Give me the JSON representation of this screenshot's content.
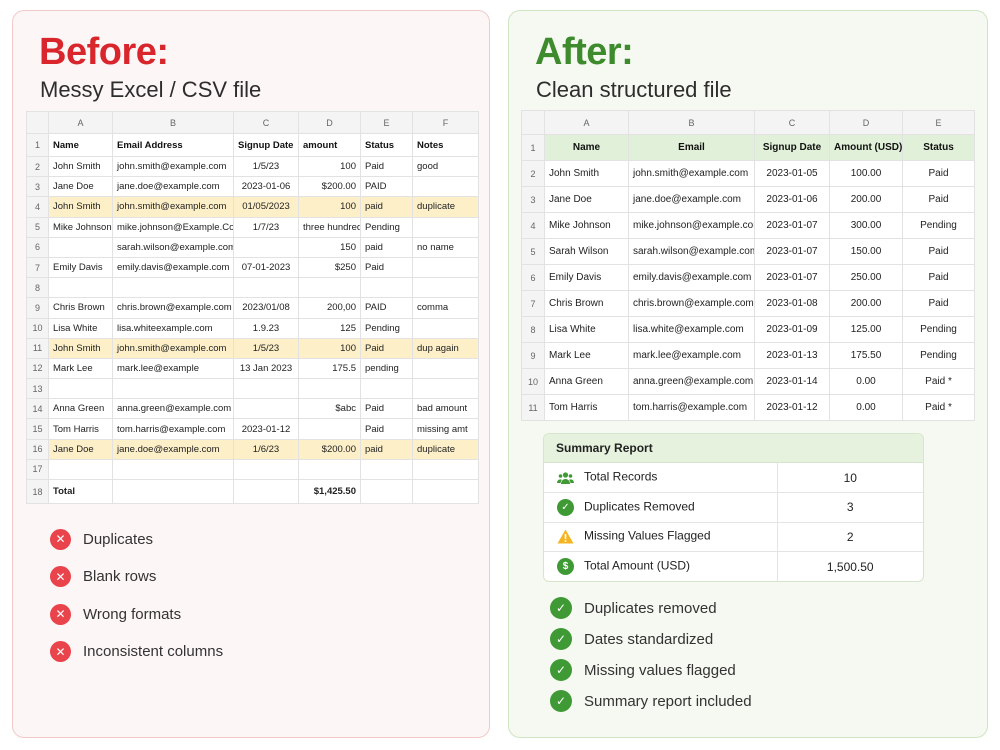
{
  "before": {
    "title": "Before:",
    "subtitle": "Messy Excel / CSV file",
    "columns": [
      "A",
      "B",
      "C",
      "D",
      "E",
      "F"
    ],
    "rows": [
      {
        "n": "1",
        "cells": [
          "Name",
          "Email Address",
          "Signup Date",
          "amount",
          "Status",
          "Notes"
        ]
      },
      {
        "n": "2",
        "cells": [
          "John Smith",
          "john.smith@example.com",
          "1/5/23",
          "100",
          "Paid",
          "good"
        ]
      },
      {
        "n": "3",
        "cells": [
          "Jane Doe",
          "jane.doe@example.com",
          "2023-01-06",
          "$200.00",
          "PAID",
          ""
        ]
      },
      {
        "n": "4",
        "cells": [
          "John Smith",
          "john.smith@example.com",
          "01/05/2023",
          "100",
          "paid",
          "duplicate"
        ]
      },
      {
        "n": "5",
        "cells": [
          "Mike Johnson",
          "mike.johnson@Example.Com",
          "1/7/23",
          "three hundred",
          "Pending",
          ""
        ]
      },
      {
        "n": "6",
        "cells": [
          "",
          "sarah.wilson@example.com",
          "",
          "150",
          "paid",
          "no name"
        ]
      },
      {
        "n": "7",
        "cells": [
          "Emily Davis",
          "emily.davis@example.com",
          "07-01-2023",
          "$250",
          "Paid",
          ""
        ]
      },
      {
        "n": "8",
        "cells": [
          "",
          "",
          "",
          "",
          "",
          ""
        ]
      },
      {
        "n": "9",
        "cells": [
          "Chris Brown",
          "chris.brown@example.com",
          "2023/01/08",
          "200,00",
          "PAID",
          "comma"
        ]
      },
      {
        "n": "10",
        "cells": [
          "Lisa White",
          "lisa.whiteexample.com",
          "1.9.23",
          "125",
          "Pending",
          ""
        ]
      },
      {
        "n": "11",
        "cells": [
          "John Smith",
          "john.smith@example.com",
          "1/5/23",
          "100",
          "Paid",
          "dup again"
        ]
      },
      {
        "n": "12",
        "cells": [
          "Mark Lee",
          "mark.lee@example",
          "13 Jan 2023",
          "175.5",
          "pending",
          ""
        ]
      },
      {
        "n": "13",
        "cells": [
          "",
          "",
          "",
          "",
          "",
          ""
        ]
      },
      {
        "n": "14",
        "cells": [
          "Anna Green",
          "anna.green@example.com",
          "",
          "$abc",
          "Paid",
          "bad amount"
        ]
      },
      {
        "n": "15",
        "cells": [
          "Tom Harris",
          "tom.harris@example.com",
          "2023-01-12",
          "",
          "Paid",
          "missing amt"
        ]
      },
      {
        "n": "16",
        "cells": [
          "Jane Doe",
          "jane.doe@example.com",
          "1/6/23",
          "$200.00",
          "paid",
          "duplicate"
        ]
      },
      {
        "n": "17",
        "cells": [
          "",
          "",
          "",
          "",
          "",
          ""
        ]
      },
      {
        "n": "18",
        "cells": [
          "Total",
          "",
          "",
          "$1,425.50",
          "",
          ""
        ]
      }
    ],
    "issues": [
      "Duplicates",
      "Blank rows",
      "Wrong formats",
      "Inconsistent columns"
    ]
  },
  "after": {
    "title": "After:",
    "subtitle": "Clean structured file",
    "columns": [
      "A",
      "B",
      "C",
      "D",
      "E"
    ],
    "rows": [
      {
        "n": "1",
        "cells": [
          "Name",
          "Email",
          "Signup Date",
          "Amount (USD)",
          "Status"
        ]
      },
      {
        "n": "2",
        "cells": [
          "John Smith",
          "john.smith@example.com",
          "2023-01-05",
          "100.00",
          "Paid"
        ]
      },
      {
        "n": "3",
        "cells": [
          "Jane Doe",
          "jane.doe@example.com",
          "2023-01-06",
          "200.00",
          "Paid"
        ]
      },
      {
        "n": "4",
        "cells": [
          "Mike Johnson",
          "mike.johnson@example.com",
          "2023-01-07",
          "300.00",
          "Pending"
        ]
      },
      {
        "n": "5",
        "cells": [
          "Sarah Wilson",
          "sarah.wilson@example.com",
          "2023-01-07",
          "150.00",
          "Paid"
        ]
      },
      {
        "n": "6",
        "cells": [
          "Emily Davis",
          "emily.davis@example.com",
          "2023-01-07",
          "250.00",
          "Paid"
        ]
      },
      {
        "n": "7",
        "cells": [
          "Chris Brown",
          "chris.brown@example.com",
          "2023-01-08",
          "200.00",
          "Paid"
        ]
      },
      {
        "n": "8",
        "cells": [
          "Lisa White",
          "lisa.white@example.com",
          "2023-01-09",
          "125.00",
          "Pending"
        ]
      },
      {
        "n": "9",
        "cells": [
          "Mark Lee",
          "mark.lee@example.com",
          "2023-01-13",
          "175.50",
          "Pending"
        ]
      },
      {
        "n": "10",
        "cells": [
          "Anna Green",
          "anna.green@example.com",
          "2023-01-14",
          "0.00",
          "Paid *"
        ]
      },
      {
        "n": "11",
        "cells": [
          "Tom Harris",
          "tom.harris@example.com",
          "2023-01-12",
          "0.00",
          "Paid *"
        ]
      }
    ],
    "summary": {
      "title": "Summary Report",
      "items": [
        {
          "label": "Total Records",
          "value": "10",
          "icon": "users-icon"
        },
        {
          "label": "Duplicates Removed",
          "value": "3",
          "icon": "check-circle-icon"
        },
        {
          "label": "Missing Values Flagged",
          "value": "2",
          "icon": "warning-icon"
        },
        {
          "label": "Total Amount (USD)",
          "value": "1,500.50",
          "icon": "dollar-circle-icon"
        }
      ]
    },
    "benefits": [
      "Duplicates removed",
      "Dates standardized",
      "Missing values flagged",
      "Summary report included"
    ]
  },
  "colors": {
    "red": "#d8262c",
    "green": "#3d8b2d",
    "duplicate_highlight": "#fdf0c9",
    "header_green": "#e1f0d8"
  }
}
